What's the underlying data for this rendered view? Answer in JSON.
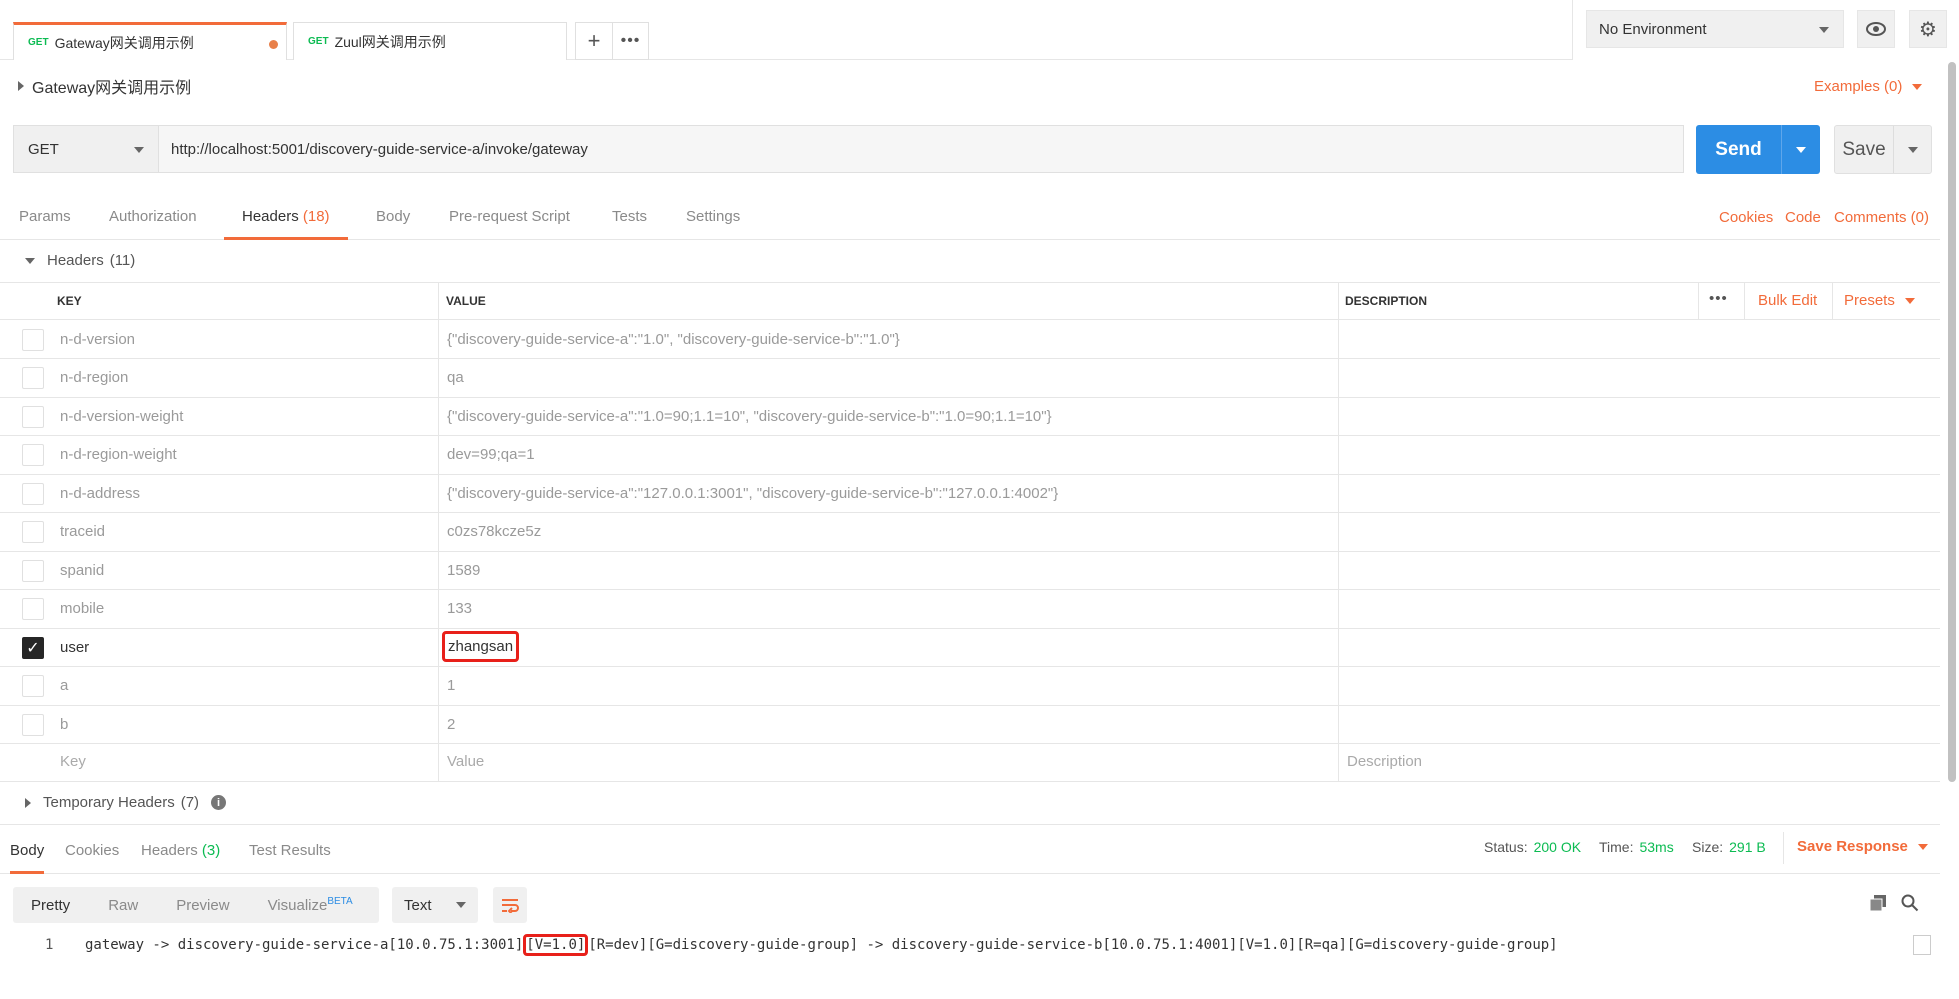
{
  "tabs": [
    {
      "method": "GET",
      "name": "Gateway网关调用示例",
      "unsaved": true
    },
    {
      "method": "GET",
      "name": "Zuul网关调用示例"
    }
  ],
  "environment": {
    "selected": "No Environment"
  },
  "request": {
    "name": "Gateway网关调用示例",
    "examples_label": "Examples (0)",
    "method": "GET",
    "url": "http://localhost:5001/discovery-guide-service-a/invoke/gateway",
    "send_label": "Send",
    "save_label": "Save"
  },
  "request_tabs": {
    "params": "Params",
    "authorization": "Authorization",
    "headers": "Headers",
    "headers_count": "(18)",
    "body": "Body",
    "prerequest": "Pre-request Script",
    "tests": "Tests",
    "settings": "Settings",
    "cookies": "Cookies",
    "code": "Code",
    "comments": "Comments (0)"
  },
  "headers_section": {
    "title": "Headers",
    "count": "(11)",
    "col_key": "KEY",
    "col_value": "VALUE",
    "col_description": "DESCRIPTION",
    "bulk_edit": "Bulk Edit",
    "presets": "Presets",
    "placeholder_key": "Key",
    "placeholder_value": "Value",
    "placeholder_description": "Description",
    "rows": [
      {
        "key": "n-d-version",
        "value": "{\"discovery-guide-service-a\":\"1.0\", \"discovery-guide-service-b\":\"1.0\"}",
        "checked": false
      },
      {
        "key": "n-d-region",
        "value": "qa",
        "checked": false
      },
      {
        "key": "n-d-version-weight",
        "value": "{\"discovery-guide-service-a\":\"1.0=90;1.1=10\", \"discovery-guide-service-b\":\"1.0=90;1.1=10\"}",
        "checked": false
      },
      {
        "key": "n-d-region-weight",
        "value": "dev=99;qa=1",
        "checked": false
      },
      {
        "key": "n-d-address",
        "value": "{\"discovery-guide-service-a\":\"127.0.0.1:3001\", \"discovery-guide-service-b\":\"127.0.0.1:4002\"}",
        "checked": false
      },
      {
        "key": "traceid",
        "value": "c0zs78kcze5z",
        "checked": false
      },
      {
        "key": "spanid",
        "value": "1589",
        "checked": false
      },
      {
        "key": "mobile",
        "value": "133",
        "checked": false
      },
      {
        "key": "user",
        "value": "zhangsan",
        "checked": true
      },
      {
        "key": "a",
        "value": "1",
        "checked": false
      },
      {
        "key": "b",
        "value": "2",
        "checked": false
      }
    ]
  },
  "temporary_headers": {
    "title": "Temporary Headers",
    "count": "(7)"
  },
  "response": {
    "tabs": {
      "body": "Body",
      "cookies": "Cookies",
      "headers": "Headers",
      "headers_count": "(3)",
      "test_results": "Test Results"
    },
    "status_label": "Status:",
    "status_value": "200 OK",
    "time_label": "Time:",
    "time_value": "53ms",
    "size_label": "Size:",
    "size_value": "291 B",
    "save_response": "Save Response",
    "view_modes": {
      "pretty": "Pretty",
      "raw": "Raw",
      "preview": "Preview",
      "visualize": "Visualize",
      "beta": "BETA"
    },
    "format": "Text",
    "line_number": "1",
    "body_before": "gateway -> discovery-guide-service-a[10.0.75.1:3001]",
    "body_highlight": "[V=1.0]",
    "body_after": "[R=dev][G=discovery-guide-group] -> discovery-guide-service-b[10.0.75.1:4001][V=1.0][R=qa][G=discovery-guide-group]"
  },
  "colors": {
    "accent": "#f26b3a",
    "send": "#2c8de4",
    "status_ok": "#0cbb52",
    "highlight_box": "#e8201a"
  }
}
